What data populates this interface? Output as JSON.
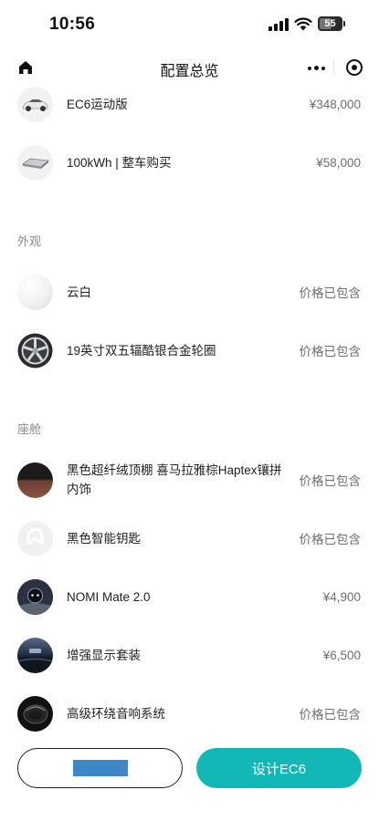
{
  "status_bar": {
    "time": "10:56",
    "battery": "55"
  },
  "nav": {
    "title": "配置总览"
  },
  "base_items": [
    {
      "label": "EC6运动版",
      "price": "¥348,000",
      "thumb": "car-thumbnail"
    },
    {
      "label": "100kWh | 整车购买",
      "price": "¥58,000",
      "thumb": "battery-pack-thumbnail"
    }
  ],
  "exterior": {
    "title": "外观",
    "items": [
      {
        "label": "云白",
        "price": "价格已包含",
        "thumb": "white-paint-swatch"
      },
      {
        "label": "19英寸双五辐酷银合金轮圈",
        "price": "价格已包含",
        "thumb": "wheel-thumbnail"
      }
    ]
  },
  "cabin": {
    "title": "座舱",
    "items": [
      {
        "label": "黑色超纤绒顶棚 喜马拉雅棕Haptex镶拼内饰",
        "price": "价格已包含",
        "thumb": "interior-swatch"
      },
      {
        "label": "黑色智能钥匙",
        "price": "价格已包含",
        "thumb": "key-thumbnail"
      },
      {
        "label": "NOMI Mate 2.0",
        "price": "¥4,900",
        "thumb": "nomi-thumbnail"
      },
      {
        "label": "增强显示套装",
        "price": "¥6,500",
        "thumb": "display-thumbnail"
      },
      {
        "label": "高级环绕音响系统",
        "price": "价格已包含",
        "thumb": "speaker-thumbnail"
      }
    ]
  },
  "buttons": {
    "primary_label": "设计EC6"
  },
  "colors": {
    "accent": "#12b8b6",
    "redaction": "#3f86c6"
  }
}
